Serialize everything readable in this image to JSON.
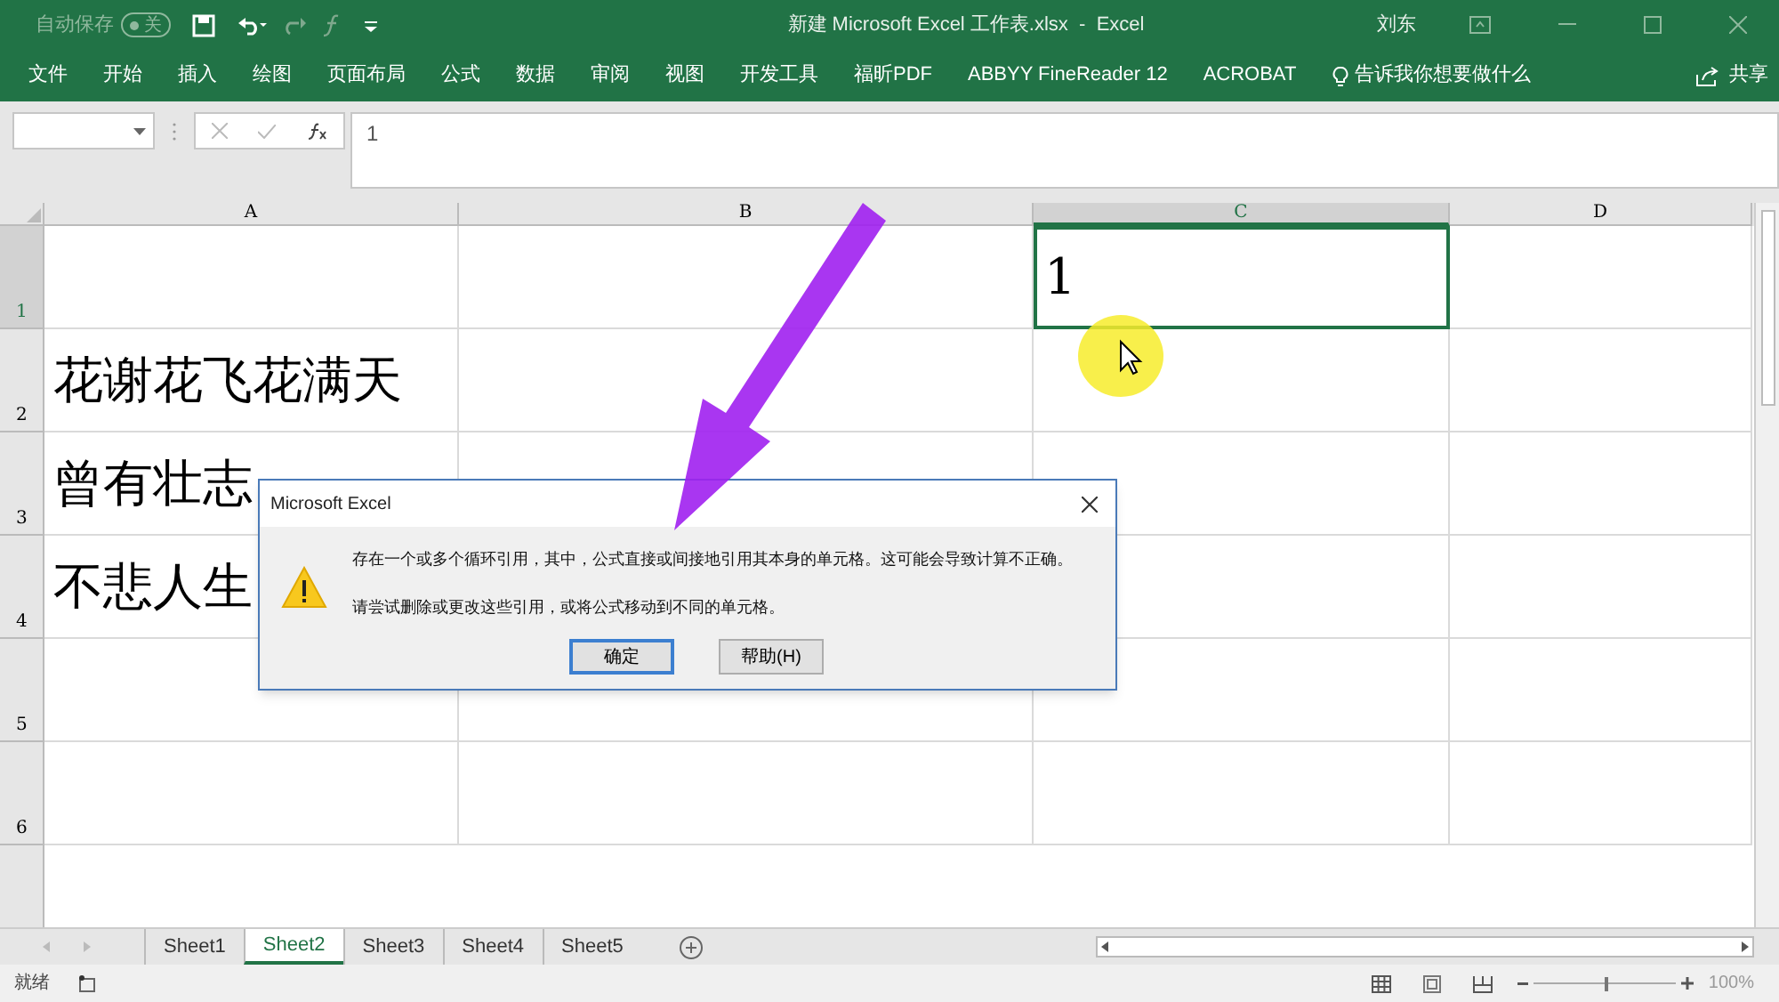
{
  "window": {
    "title": "新建 Microsoft Excel 工作表.xlsx  -  Excel",
    "user": "刘东"
  },
  "quick_access": {
    "autosave_label": "自动保存",
    "autosave_state": "关",
    "autosave_on": false
  },
  "ribbon_tabs": [
    "文件",
    "开始",
    "插入",
    "绘图",
    "页面布局",
    "公式",
    "数据",
    "审阅",
    "视图",
    "开发工具",
    "福昕PDF",
    "ABBYY FineReader 12",
    "ACROBAT"
  ],
  "tell_me": "告诉我你想要做什么",
  "share": "共享",
  "formula_bar": {
    "value": "1"
  },
  "sheet": {
    "columns": [
      {
        "label": "A",
        "selected": false
      },
      {
        "label": "B",
        "selected": false
      },
      {
        "label": "C",
        "selected": true
      },
      {
        "label": "D",
        "selected": false
      }
    ],
    "rows": [
      {
        "label": "1",
        "selected": true,
        "cells": [
          {},
          {},
          {
            "text": "1"
          },
          {}
        ]
      },
      {
        "label": "2",
        "selected": false,
        "cells": [
          {
            "text": "花谢花飞花满天"
          },
          {},
          {},
          {}
        ]
      },
      {
        "label": "3",
        "selected": false,
        "cells": [
          {
            "text": "曾有壮志"
          },
          {},
          {},
          {}
        ]
      },
      {
        "label": "4",
        "selected": false,
        "cells": [
          {
            "text": "不悲人生"
          },
          null,
          {},
          {}
        ]
      },
      {
        "label": "5",
        "selected": false,
        "cells": [
          {},
          {},
          {},
          {}
        ]
      },
      {
        "label": "6",
        "selected": false,
        "cells": [
          {},
          {},
          {},
          {}
        ]
      }
    ]
  },
  "sheet_tabs": [
    {
      "label": "Sheet1",
      "selected": false
    },
    {
      "label": "Sheet2",
      "selected": true
    },
    {
      "label": "Sheet3",
      "selected": false
    },
    {
      "label": "Sheet4",
      "selected": false
    },
    {
      "label": "Sheet5",
      "selected": false
    }
  ],
  "status_bar": {
    "status": "就绪",
    "zoom": "100%",
    "zoom_slider": {
      "level": 0.5
    }
  },
  "dialog": {
    "title": "Microsoft Excel",
    "messages": [
      "存在一个或多个循环引用，其中，公式直接或间接地引用其本身的单元格。这可能会导致计算不正确。",
      "请尝试删除或更改这些引用，或将公式移动到不同的单元格。"
    ],
    "buttons": [
      {
        "label": "确定",
        "default": true
      },
      {
        "label": "帮助(H)",
        "default": false
      }
    ]
  }
}
